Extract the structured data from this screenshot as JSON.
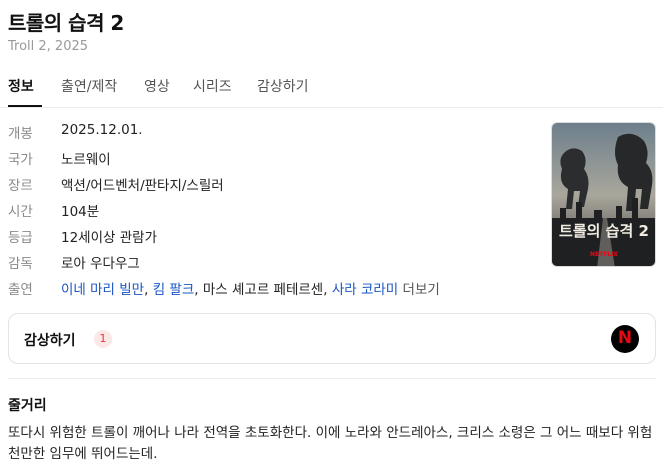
{
  "header": {
    "title": "트롤의 습격 2",
    "subtitle": "Troll 2, 2025"
  },
  "tabs": [
    {
      "label": "정보",
      "active": true
    },
    {
      "label": "출연/제작"
    },
    {
      "label": "영상"
    },
    {
      "label": "시리즈"
    },
    {
      "label": "감상하기"
    }
  ],
  "info": {
    "release": {
      "key": "개봉",
      "value": "2025.12.01."
    },
    "country": {
      "key": "국가",
      "value": "노르웨이"
    },
    "genre": {
      "key": "장르",
      "value": "액션/어드벤처/판타지/스릴러"
    },
    "runtime": {
      "key": "시간",
      "value": "104분"
    },
    "rating": {
      "key": "등급",
      "value": "12세이상 관람가"
    },
    "director": {
      "key": "감독",
      "value": "로아 우다우그"
    },
    "cast": {
      "key": "출연",
      "names": [
        "이네 마리 빌만",
        "킴 팔크",
        "마스 셰고르 페테르센",
        "사라 코라미"
      ],
      "separator": ", ",
      "more": "더보기"
    }
  },
  "poster": {
    "title_text": "트롤의 습격 2",
    "brand_text": "NETFLIX"
  },
  "watch": {
    "label": "감상하기",
    "count": "1",
    "provider_icon": "netflix-icon",
    "provider_letter": "N"
  },
  "synopsis": {
    "title": "줄거리",
    "text": "또다시 위험한 트롤이 깨어나 나라 전역을 초토화한다. 이에 노라와 안드레아스, 크리스 소령은 그 어느 때보다 위험천만한 임무에 뛰어드는데."
  },
  "colors": {
    "link": "#1a55c4",
    "netflix_red": "#e50914",
    "badge_bg": "#fde8e8"
  }
}
